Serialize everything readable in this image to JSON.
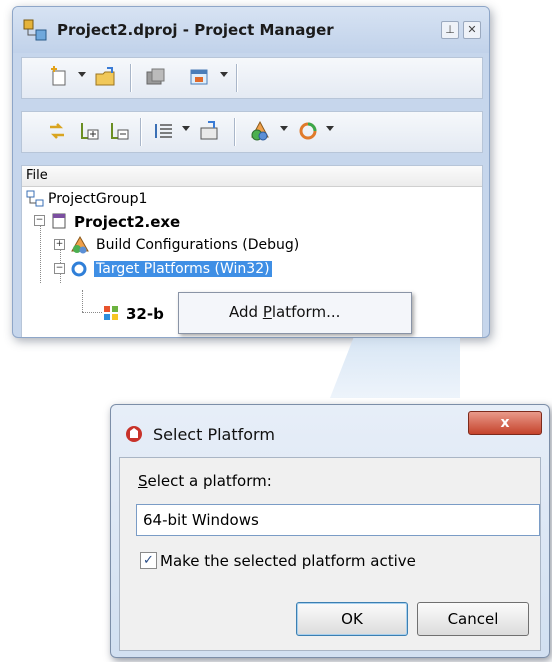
{
  "project_manager": {
    "title": "Project2.dproj - Project Manager",
    "title_buttons": [
      "pin-icon",
      "close-icon"
    ],
    "toolbar_row1": [
      "new-item-icon",
      "dropdown-arrow",
      "open-folder-icon",
      "build-icon",
      "compile-settings-icon",
      "dropdown-arrow"
    ],
    "toolbar_row2": [
      "sync-icon",
      "add-file-icon",
      "remove-file-icon",
      "sort-list-icon",
      "dropdown-arrow",
      "options-icon",
      "configuration-icon",
      "dropdown-arrow",
      "platform-icon",
      "dropdown-arrow"
    ],
    "column_header": "File",
    "tree": {
      "group": "ProjectGroup1",
      "project": "Project2.exe",
      "build_configurations": "Build Configurations (Debug)",
      "target_platforms": "Target Platforms (Win32)",
      "platform_32": "32-b"
    },
    "context_menu": {
      "add_platform_prefix": "Add ",
      "add_platform_accel": "P",
      "add_platform_suffix": "latform..."
    }
  },
  "dialog": {
    "title": "Select Platform",
    "close_label": "x",
    "label_accel": "S",
    "label_rest": "elect a platform:",
    "selected_platform": "64-bit Windows",
    "checkbox_checked": true,
    "checkbox_mark": "✓",
    "checkbox_label": "Make the selected platform active",
    "ok_label": "OK",
    "cancel_label": "Cancel"
  },
  "colors": {
    "selection": "#3f8fe5",
    "close_red": "#c5432c",
    "titlebar": "#c6d6ec"
  }
}
